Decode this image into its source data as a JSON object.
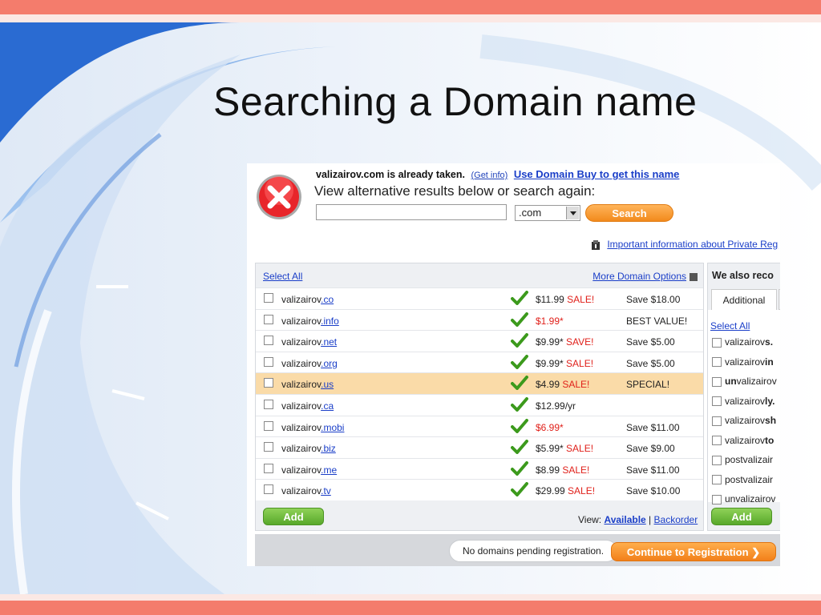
{
  "slide": {
    "title": "Searching a Domain name"
  },
  "status": {
    "taken_text": "valizairov.com is already taken.",
    "get_info": "(Get info)",
    "use_buy": "Use Domain Buy to get this name",
    "view_alt": "View alternative results below or search again:"
  },
  "search": {
    "input_value": "",
    "tld": ".com",
    "button": "Search"
  },
  "private_info": "Important information about Private Reg",
  "table": {
    "select_all": "Select All",
    "more_options": "More Domain Options",
    "rows": [
      {
        "name": "valizairov",
        "tld": ".co",
        "price": "$11.99",
        "tag": " SALE!",
        "note": "Save $18.00",
        "price_red": false
      },
      {
        "name": "valizairov",
        "tld": ".info",
        "price": "$1.99*",
        "tag": "",
        "note": "BEST VALUE!",
        "price_red": true
      },
      {
        "name": "valizairov",
        "tld": ".net",
        "price": "$9.99*",
        "tag": " SAVE!",
        "note": "Save $5.00",
        "price_red": false
      },
      {
        "name": "valizairov",
        "tld": ".org",
        "price": "$9.99*",
        "tag": " SALE!",
        "note": "Save $5.00",
        "price_red": false
      },
      {
        "name": "valizairov",
        "tld": ".us",
        "price": "$4.99",
        "tag": " SALE!",
        "note": "SPECIAL!",
        "price_red": false,
        "highlight": true
      },
      {
        "name": "valizairov",
        "tld": ".ca",
        "price": "$12.99/yr",
        "tag": "",
        "note": "",
        "price_red": false
      },
      {
        "name": "valizairov",
        "tld": ".mobi",
        "price": "$6.99*",
        "tag": "",
        "note": "Save $11.00",
        "price_red": true
      },
      {
        "name": "valizairov",
        "tld": ".biz",
        "price": "$5.99*",
        "tag": " SALE!",
        "note": "Save $9.00",
        "price_red": false
      },
      {
        "name": "valizairov",
        "tld": ".me",
        "price": "$8.99",
        "tag": " SALE!",
        "note": "Save $11.00",
        "price_red": false
      },
      {
        "name": "valizairov",
        "tld": ".tv",
        "price": "$29.99",
        "tag": " SALE!",
        "note": "Save $10.00",
        "price_red": false
      }
    ],
    "add_button": "Add",
    "view_label": "View: ",
    "view_available": "Available",
    "view_sep": " | ",
    "view_backorder": "Backorder"
  },
  "recommend": {
    "title": "We also reco",
    "tab_additional": "Additional",
    "select_all": "Select All",
    "items": [
      {
        "pre": "valizairov",
        "bold": "s.",
        "post": ""
      },
      {
        "pre": "valizairov",
        "bold": "in",
        "post": ""
      },
      {
        "pre": "",
        "bold": "un",
        "post": "valizairov"
      },
      {
        "pre": "valizairov",
        "bold": "ly.",
        "post": ""
      },
      {
        "pre": "valizairov",
        "bold": "sh",
        "post": ""
      },
      {
        "pre": "valizairov",
        "bold": "to",
        "post": ""
      },
      {
        "pre": "postvalizair",
        "bold": "",
        "post": ""
      },
      {
        "pre": "postvalizair",
        "bold": "",
        "post": ""
      },
      {
        "pre": "unvalizairov",
        "bold": "",
        "post": ""
      }
    ],
    "add_button": "Add"
  },
  "footer": {
    "pending": "No domains pending registration.",
    "continue": "Continue to Registration"
  },
  "colors": {
    "accent_orange": "#f28a1c",
    "link_blue": "#1a3ec8",
    "sale_red": "#e0201a",
    "add_green": "#58a82a",
    "highlight": "#fadba8"
  }
}
